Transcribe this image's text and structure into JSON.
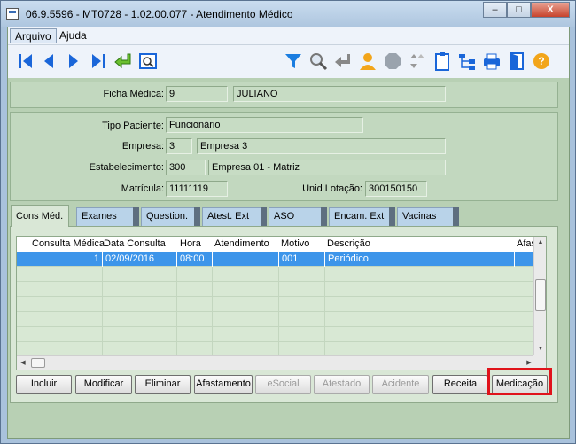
{
  "window": {
    "title": "06.9.5596 - MT0728 - 1.02.00.077 - Atendimento Médico",
    "min_label": "–",
    "max_label": "□",
    "close_label": "X"
  },
  "menu": [
    {
      "label": "Arquivo"
    },
    {
      "label": "Ajuda"
    }
  ],
  "toolbar_icons": [
    "first-record-icon",
    "previous-record-icon",
    "next-record-icon",
    "last-record-icon",
    "return-icon",
    "preview-icon",
    "filter-icon",
    "search-icon",
    "enter-icon",
    "user-icon",
    "stop-icon",
    "sort-icon",
    "clipboard-icon",
    "hierarchy-icon",
    "print-icon",
    "exit-icon",
    "help-icon"
  ],
  "ficha": {
    "label": "Ficha Médica:",
    "number": "9",
    "name": "JULIANO"
  },
  "patient": {
    "tipo_label": "Tipo Paciente:",
    "tipo_value": "Funcionário",
    "empresa_label": "Empresa:",
    "empresa_code": "3",
    "empresa_name": "Empresa 3",
    "estab_label": "Estabelecimento:",
    "estab_code": "300",
    "estab_name": "Empresa 01 - Matriz",
    "matricula_label": "Matrícula:",
    "matricula_value": "11111119",
    "lotacao_label": "Unid Lotação:",
    "lotacao_value": "300150150"
  },
  "tabs": [
    {
      "label": "Cons Méd.",
      "active": true
    },
    {
      "label": "Exames"
    },
    {
      "label": "Question."
    },
    {
      "label": "Atest. Ext"
    },
    {
      "label": "ASO"
    },
    {
      "label": "Encam. Ext"
    },
    {
      "label": "Vacinas"
    }
  ],
  "grid": {
    "columns": [
      "Consulta Médica",
      "Data Consulta",
      "Hora",
      "Atendimento",
      "Motivo",
      "Descrição",
      "Afas"
    ],
    "rows": [
      {
        "consulta": "1",
        "data": "02/09/2016",
        "hora": "08:00",
        "atendimento": "",
        "motivo": "001",
        "descricao": "Periódico",
        "afas": ""
      }
    ]
  },
  "buttons": [
    {
      "label": "Incluir",
      "enabled": true
    },
    {
      "label": "Modificar",
      "enabled": true
    },
    {
      "label": "Eliminar",
      "enabled": true
    },
    {
      "label": "Afastamento",
      "enabled": true
    },
    {
      "label": "eSocial",
      "enabled": false
    },
    {
      "label": "Atestado",
      "enabled": false
    },
    {
      "label": "Acidente",
      "enabled": false
    },
    {
      "label": "Receita",
      "enabled": true
    },
    {
      "label": "Medicação",
      "enabled": true,
      "highlighted": true
    }
  ],
  "colors": {
    "highlight": "#e0131b",
    "selected_row": "#3d95ea",
    "panel": "#b8d0b4"
  }
}
